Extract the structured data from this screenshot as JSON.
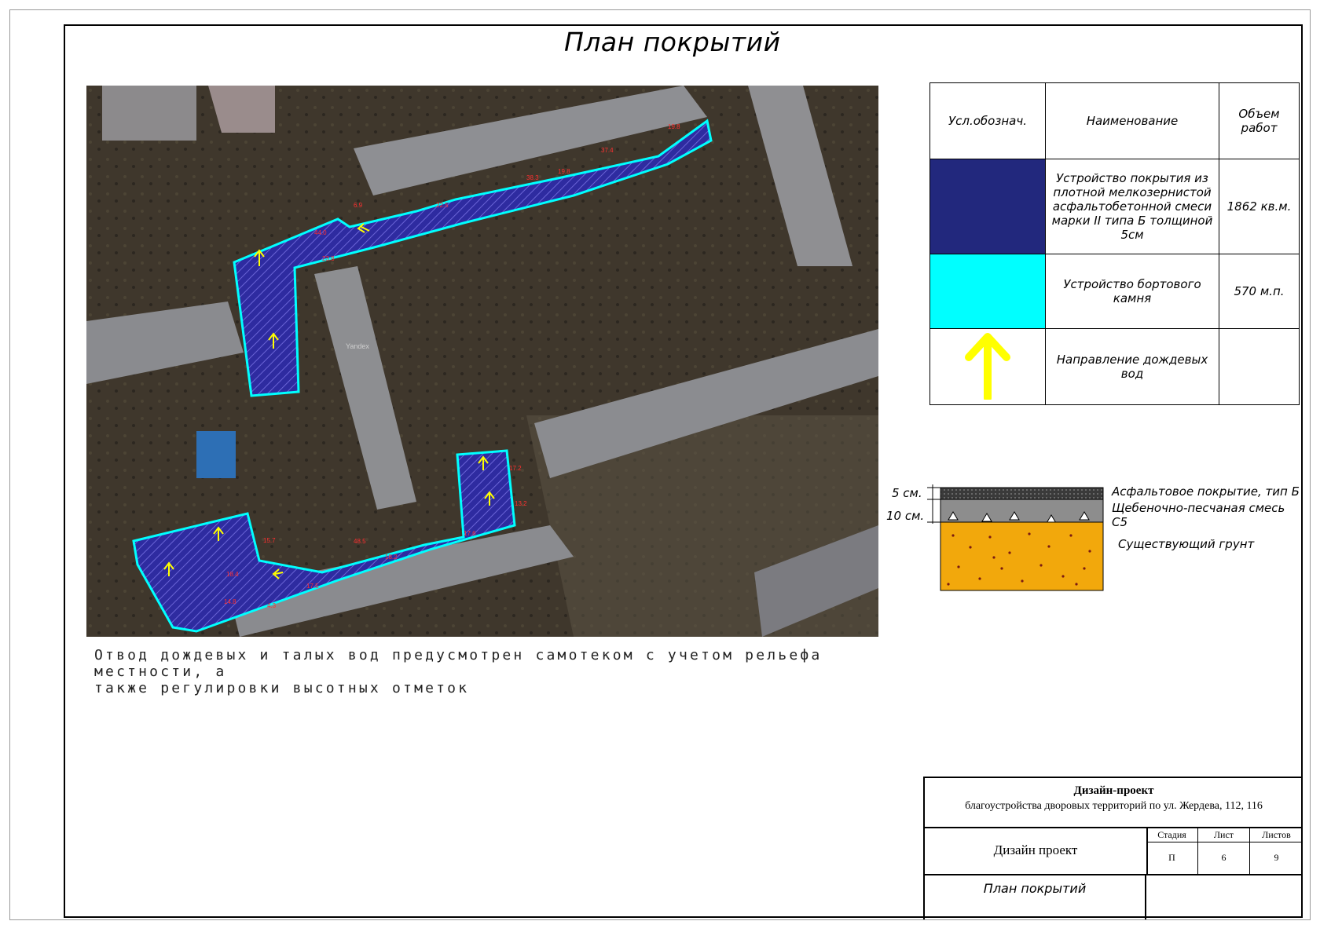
{
  "page": {
    "title": "План покрытий"
  },
  "map": {
    "watermark": "Yandex",
    "dimensions": [
      "44.0",
      "23.8",
      "22.5",
      "19.8",
      "38.3",
      "37.4",
      "19.8",
      "6.9",
      "48.5",
      "18.2",
      "17.5",
      "17.6",
      "15.7",
      "17.2",
      "18.4",
      "14.8",
      "4.3",
      "13.2"
    ]
  },
  "note": {
    "line1": "Отвод дождевых и талых вод предусмотрен самотеком с учетом рельефа местности, а",
    "line2": "также регулировки высотных отметок"
  },
  "legend": {
    "headers": {
      "symbol": "Усл.обознач.",
      "name": "Наименование",
      "volume": "Объем работ"
    },
    "rows": [
      {
        "swatch_color": "#22287d",
        "name": "Устройство покрытия из плотной мелкозернистой асфальтобетонной смеси марки II типа Б толщиной 5см",
        "volume": "1862 кв.м."
      },
      {
        "swatch_color": "#00ffff",
        "name": "Устройство бортового камня",
        "volume": "570 м.п."
      },
      {
        "icon": "yellow-arrow-up-icon",
        "name": "Направление дождевых вод",
        "volume": ""
      }
    ]
  },
  "layers": {
    "dim1": "5 см.",
    "dim2": "10 см.",
    "layer1": "Асфальтовое покрытие, тип Б",
    "layer2": "Щебеночно-песчаная смесь С5",
    "layer3": "Существующий грунт"
  },
  "title_block": {
    "heading": "Дизайн-проект",
    "subheading": "благоустройства дворовых территорий по ул. Жердева, 112, 116",
    "stage_name": "Дизайн проект",
    "col_stage": "Стадия",
    "col_sheet": "Лист",
    "col_sheets": "Листов",
    "stage": "П",
    "sheet": "6",
    "sheets": "9",
    "sheet_name": "План покрытий"
  }
}
